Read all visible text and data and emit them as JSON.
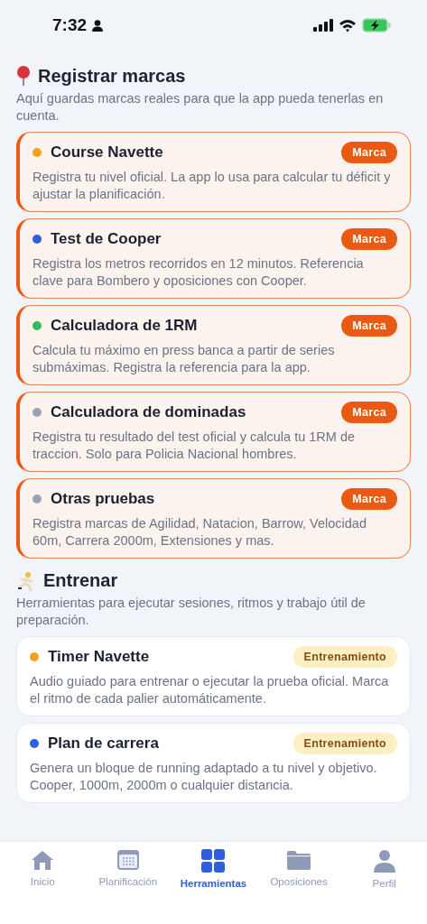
{
  "status_bar": {
    "time": "7:32"
  },
  "sections": [
    {
      "kind": "record",
      "title": "Registrar marcas",
      "description": "Aquí guardas marcas reales para que la app pueda tenerlas en cuenta.",
      "cards": [
        {
          "title": "Course Navette",
          "color": "#f2a31b",
          "badge": "Marca",
          "description": "Registra tu nivel oficial. La app lo usa para calcular tu déficit y ajustar la planificación."
        },
        {
          "title": "Test de Cooper",
          "color": "#2f5fe0",
          "badge": "Marca",
          "description": "Registra los metros recorridos en 12 minutos. Referencia clave para Bombero y oposiciones con Cooper."
        },
        {
          "title": "Calculadora de 1RM",
          "color": "#2fbf5a",
          "badge": "Marca",
          "description": "Calcula tu máximo en press banca a partir de series submáximas. Registra la referencia para la app."
        },
        {
          "title": "Calculadora de dominadas",
          "color": "#9aa3b5",
          "badge": "Marca",
          "description": "Registra tu resultado del test oficial y calcula tu 1RM de traccion. Solo para Policia Nacional hombres."
        },
        {
          "title": "Otras pruebas",
          "color": "#9aa3b5",
          "badge": "Marca",
          "description": "Registra marcas de Agilidad, Natacion, Barrow, Velocidad 60m, Carrera 2000m, Extensiones y mas."
        }
      ]
    },
    {
      "kind": "training",
      "title": "Entrenar",
      "description": "Herramientas para ejecutar sesiones, ritmos y trabajo útil de preparación.",
      "cards": [
        {
          "title": "Timer Navette",
          "color": "#f2a31b",
          "badge": "Entrenamiento",
          "description": "Audio guiado para entrenar o ejecutar la prueba oficial. Marca el ritmo de cada palier automáticamente."
        },
        {
          "title": "Plan de carrera",
          "color": "#2f5fe0",
          "badge": "Entrenamiento",
          "description": "Genera un bloque de running adaptado a tu nivel y objetivo. Cooper, 1000m, 2000m o cualquier distancia."
        }
      ]
    }
  ],
  "tab_bar": [
    {
      "label": "Inicio",
      "selected": false
    },
    {
      "label": "Planificación",
      "selected": false
    },
    {
      "label": "Herramientas",
      "selected": true
    },
    {
      "label": "Oposiciones",
      "selected": false
    },
    {
      "label": "Perfil",
      "selected": false
    }
  ]
}
